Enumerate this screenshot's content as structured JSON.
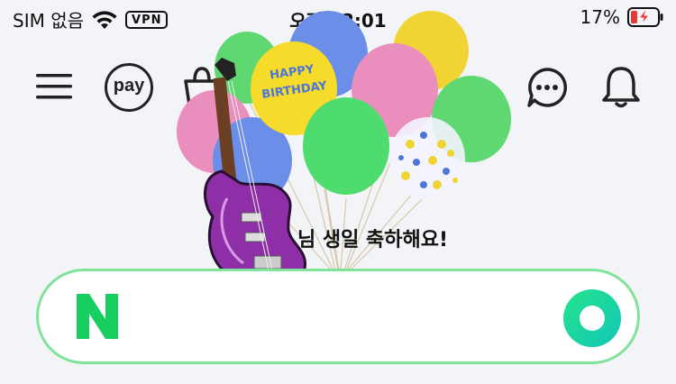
{
  "status_bar": {
    "carrier": "SIM 없음",
    "vpn": "VPN",
    "time": "오전 12:01",
    "battery_percent": "17%"
  },
  "birthday": {
    "message": "님 생일 축하해요!",
    "balloon_text": "HAPPY BIRTHDAY"
  },
  "search": {
    "placeholder": ""
  },
  "header": {
    "pay_label": "pay"
  },
  "colors": {
    "accent_green": "#03c75a",
    "search_border": "#7fe39a",
    "battery_low": "#e53935"
  }
}
